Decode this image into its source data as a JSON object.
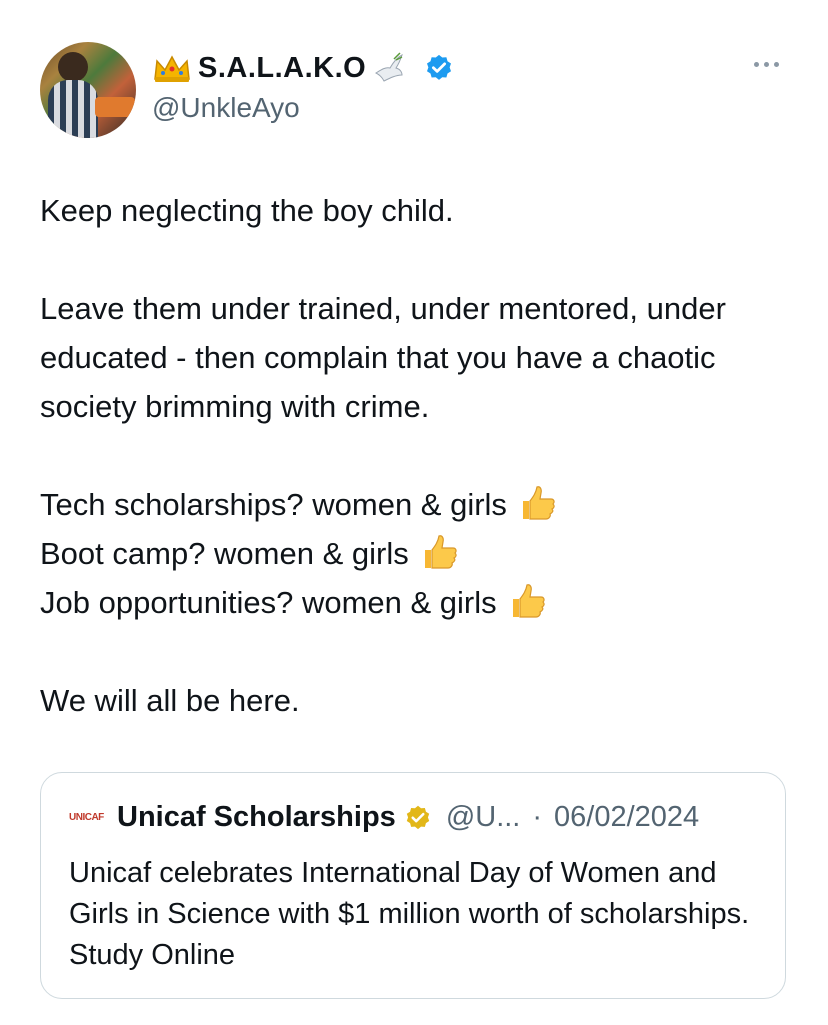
{
  "author": {
    "display_name": "S.A.L.A.K.O",
    "handle": "@UnkleAyo"
  },
  "tweet": {
    "lines": [
      "Keep neglecting the boy child.",
      "Leave them under trained, under mentored, under educated - then complain that you have a chaotic society brimming with crime.",
      "Tech scholarships? women & girls",
      "Boot camp? women & girls",
      "Job opportunities? women & girls",
      "We will all be here."
    ]
  },
  "quoted": {
    "logo_text": "UNICAF",
    "name": "Unicaf Scholarships",
    "handle": "@U...",
    "separator": "·",
    "date": "06/02/2024",
    "text": "Unicaf celebrates International Day of Women and Girls in Science with $1 million worth of scholarships. Study Online"
  },
  "icons": {
    "crown": "crown-emoji",
    "dove": "dove-emoji",
    "verified": "verified-badge-blue",
    "thumbs": "thumbs-up-emoji",
    "business_verified": "verified-badge-gold",
    "more": "more-horizontal"
  },
  "colors": {
    "verified_blue": "#1d9bf0",
    "verified_gold": "#e2b719",
    "secondary_text": "#536471",
    "border": "#cfd9de"
  }
}
